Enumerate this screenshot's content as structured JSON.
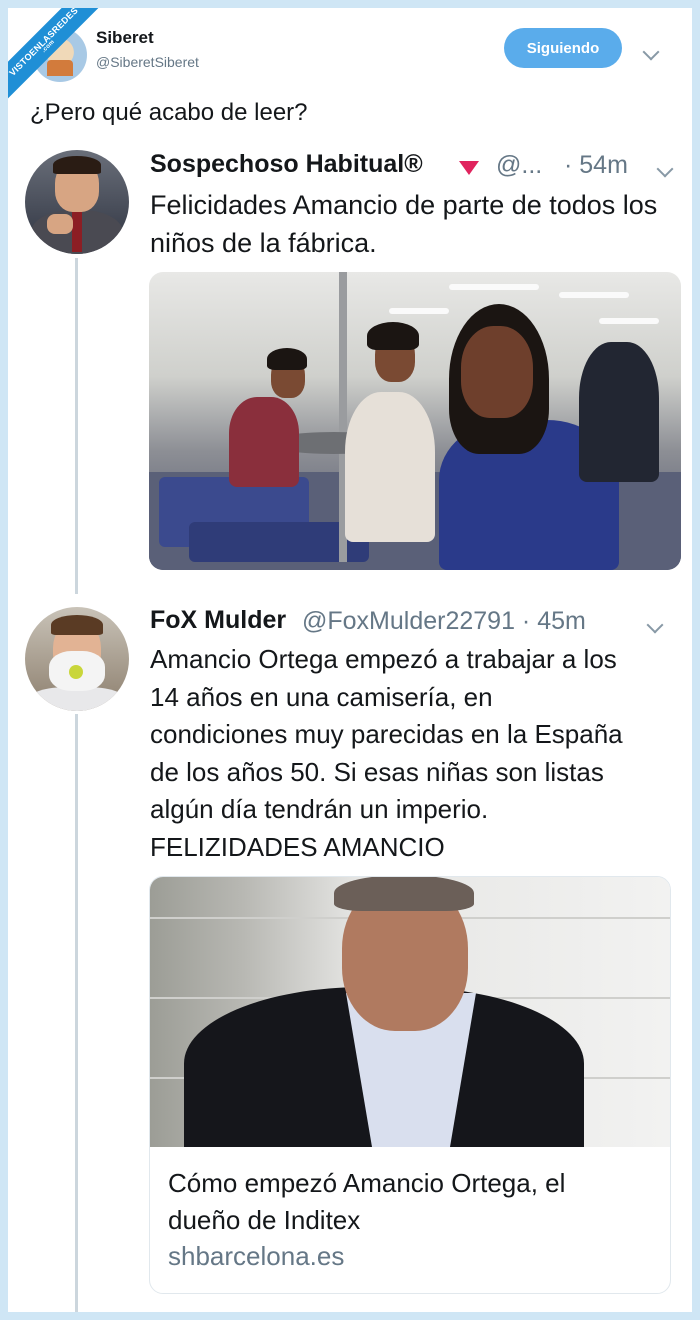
{
  "watermark": {
    "text": "VISTOENLASREDES",
    "subtext": ".com"
  },
  "tweet": {
    "author_name": "Siberet",
    "author_handle": "@SiberetSiberet",
    "follow_label": "Siguiendo",
    "text": "¿Pero qué acabo de leer?"
  },
  "replies": [
    {
      "name": "Sospechoso Habitual®",
      "handle": "@...",
      "time": "· 54m",
      "text": "Felicidades Amancio de parte de todos los niños de la fábrica."
    },
    {
      "name": "FoX Mulder",
      "handle": "@FoxMulder22791 · 45m",
      "text_lines": [
        "Amancio Ortega empezó a trabajar a los",
        "14 años en una camisería, en",
        "condiciones muy parecidas en la España",
        "de los años 50. Si esas niñas son listas",
        "algún día tendrán un imperio.",
        "FELIZIDADES AMANCIO"
      ]
    }
  ],
  "card": {
    "title": "Cómo empezó Amancio Ortega, el dueño de Inditex",
    "domain": "shbarcelona.es"
  },
  "colors": {
    "accent": "#5aaceb",
    "background": "#cfe6f5",
    "secondary_text": "#657786",
    "verified_badge": "#e0245e"
  }
}
